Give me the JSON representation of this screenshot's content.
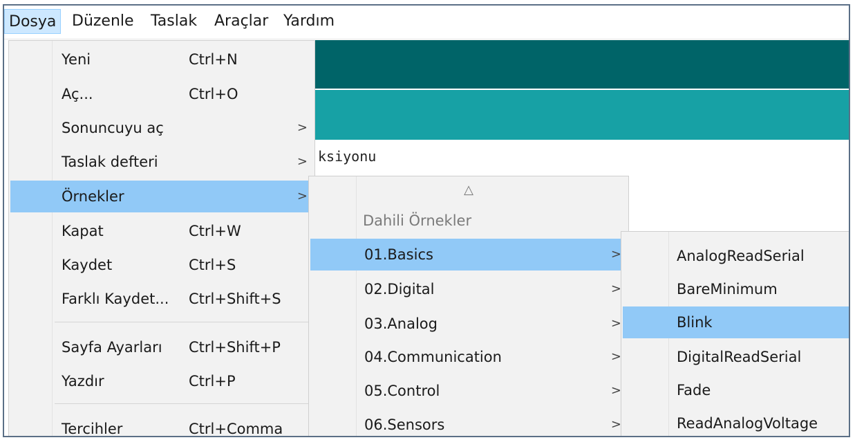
{
  "menubar": {
    "items": [
      "Dosya",
      "Düzenle",
      "Taslak",
      "Araçlar",
      "Yardım"
    ]
  },
  "editor": {
    "code_fragment": "ksiyonu"
  },
  "file_menu": {
    "items": [
      {
        "label": "Yeni",
        "shortcut": "Ctrl+N"
      },
      {
        "label": "Aç...",
        "shortcut": "Ctrl+O"
      },
      {
        "label": "Sonuncuyu aç",
        "submenu": true
      },
      {
        "label": "Taslak defteri",
        "submenu": true
      },
      {
        "label": "Örnekler",
        "submenu": true,
        "highlighted": true
      },
      {
        "label": "Kapat",
        "shortcut": "Ctrl+W"
      },
      {
        "label": "Kaydet",
        "shortcut": "Ctrl+S"
      },
      {
        "label": "Farklı Kaydet...",
        "shortcut": "Ctrl+Shift+S"
      },
      {
        "label": "Sayfa Ayarları",
        "shortcut": "Ctrl+Shift+P"
      },
      {
        "label": "Yazdır",
        "shortcut": "Ctrl+P"
      },
      {
        "label": "Tercihler",
        "shortcut": "Ctrl+Comma"
      }
    ]
  },
  "examples_menu": {
    "scroll_up_icon": "△",
    "header": "Dahili Örnekler",
    "items": [
      {
        "label": "01.Basics",
        "highlighted": true
      },
      {
        "label": "02.Digital"
      },
      {
        "label": "03.Analog"
      },
      {
        "label": "04.Communication"
      },
      {
        "label": "05.Control"
      },
      {
        "label": "06.Sensors"
      }
    ]
  },
  "basics_menu": {
    "items": [
      {
        "label": "AnalogReadSerial"
      },
      {
        "label": "BareMinimum"
      },
      {
        "label": "Blink",
        "highlighted": true
      },
      {
        "label": "DigitalReadSerial"
      },
      {
        "label": "Fade"
      },
      {
        "label": "ReadAnalogVoltage"
      }
    ]
  },
  "icons": {
    "submenu_arrow": "chevron-right-icon",
    "scroll_up": "triangle-up-icon"
  },
  "colors": {
    "highlight": "#91c9f7",
    "toolbar_dark": "#006468",
    "toolbar_teal": "#17a1a5",
    "menu_bg": "#f2f2f2"
  }
}
